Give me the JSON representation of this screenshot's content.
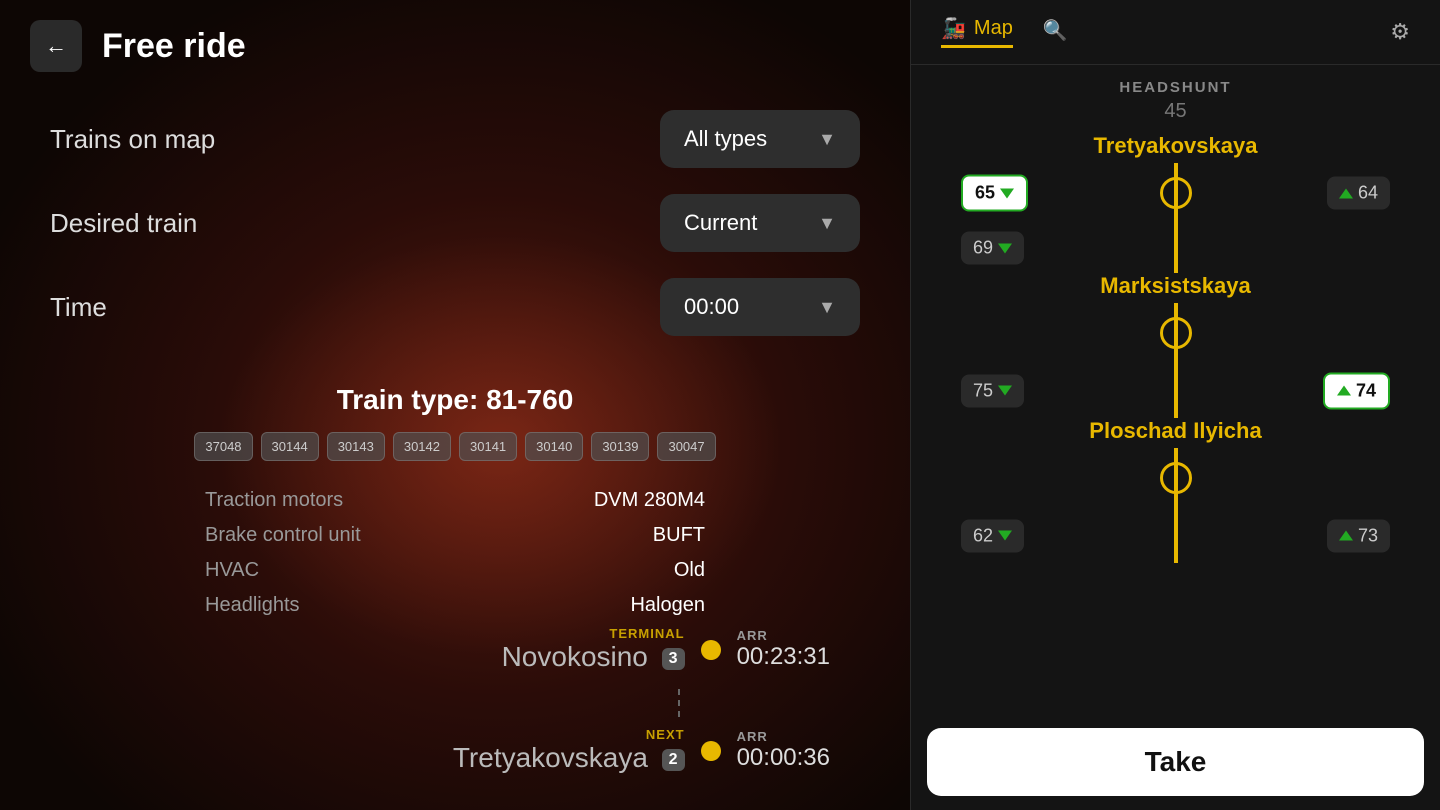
{
  "header": {
    "back_icon": "←",
    "title": "Free ride"
  },
  "left_panel": {
    "trains_on_map_label": "Trains on map",
    "trains_on_map_value": "All types",
    "desired_train_label": "Desired train",
    "desired_train_value": "Current",
    "time_label": "Time",
    "time_value": "00:00",
    "train_type_label": "Train type: 81-760",
    "car_numbers": [
      "37048",
      "30144",
      "30143",
      "30142",
      "30141",
      "30140",
      "30139",
      "30047"
    ],
    "specs": [
      {
        "key": "Traction motors",
        "value": "DVM 280M4"
      },
      {
        "key": "Brake control unit",
        "value": "BUFT"
      },
      {
        "key": "HVAC",
        "value": "Old"
      },
      {
        "key": "Headlights",
        "value": "Halogen"
      }
    ],
    "terminal": {
      "type_label": "TERMINAL",
      "station": "Novokosino",
      "badge_num": "3",
      "arr_label": "ARR",
      "arr_time": "00:23:31"
    },
    "next": {
      "type_label": "NEXT",
      "station": "Tretyakovskaya",
      "badge_num": "2",
      "arr_label": "ARR",
      "arr_time": "00:00:36"
    }
  },
  "right_panel": {
    "tabs": [
      {
        "id": "map",
        "label": "Map",
        "active": true
      },
      {
        "id": "search",
        "label": "",
        "active": false
      }
    ],
    "map_icon": "🚂",
    "search_icon": "🔍",
    "settings_icon": "⚙",
    "headshunt_label": "HEADSHUNT",
    "headshunt_num": "45",
    "stations": [
      {
        "name": "Tretyakovskaya",
        "left_badge": {
          "num": "65",
          "arrow": "down",
          "highlighted": false
        },
        "right_badge": {
          "num": "64",
          "arrow": "up",
          "highlighted": false
        },
        "has_left_train": true
      },
      {
        "name": "Marksistskaya",
        "left_badge_top": {
          "num": "69",
          "arrow": "down"
        },
        "left_badge_bottom": {
          "num": "75",
          "arrow": "down"
        },
        "right_badge_bottom": {
          "num": "74",
          "arrow": "up",
          "highlighted": true
        }
      },
      {
        "name": "Ploschad Ilyicha",
        "left_badge": {
          "num": "62",
          "arrow": "down"
        },
        "right_badge": {
          "num": "73",
          "arrow": "up"
        }
      }
    ],
    "take_button_label": "Take"
  }
}
